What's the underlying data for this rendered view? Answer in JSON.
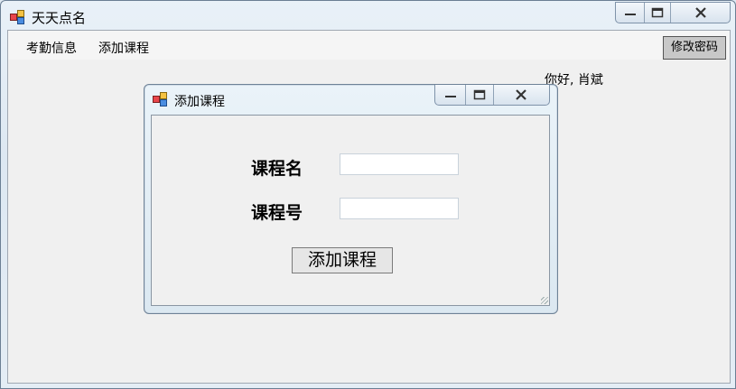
{
  "window": {
    "title": "天天点名",
    "icon": "app-window-icon"
  },
  "menu": {
    "items": [
      {
        "label": "考勤信息"
      },
      {
        "label": "添加课程"
      }
    ],
    "change_password_label": "修改密码"
  },
  "greeting": "你好, 肖斌",
  "dialog": {
    "title": "添加课程",
    "icon": "app-window-icon",
    "course_name_label": "课程名",
    "course_name_value": "",
    "course_number_label": "课程号",
    "course_number_value": "",
    "submit_label": "添加课程"
  }
}
